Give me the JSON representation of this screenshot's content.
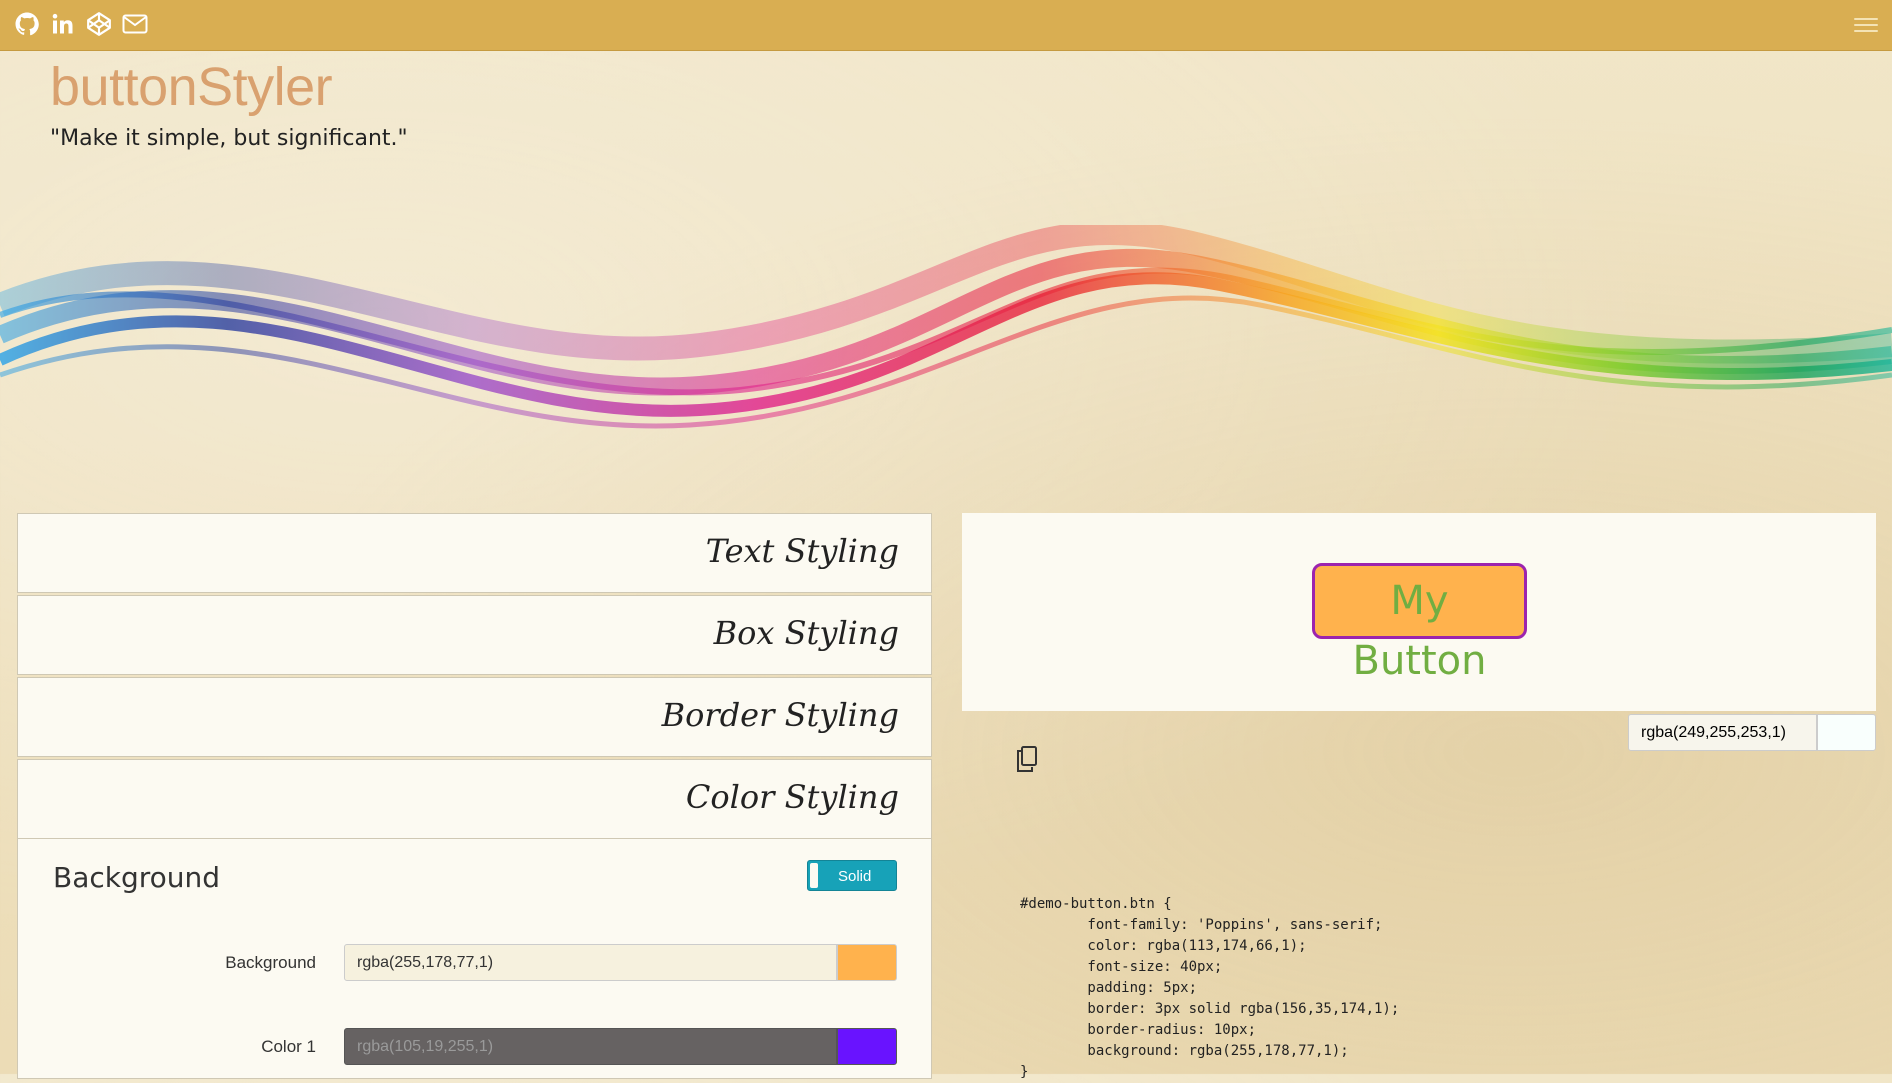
{
  "nav": {
    "icons": [
      "github-icon",
      "linkedin-icon",
      "codepen-icon",
      "mail-icon"
    ],
    "menu_icon": "hamburger-menu-icon"
  },
  "brand": "buttonStyler",
  "tagline": "\"Make it simple, but significant.\"",
  "accordion": {
    "sections": [
      "Text Styling",
      "Box Styling",
      "Border Styling",
      "Color Styling"
    ]
  },
  "color_styling": {
    "title": "Background",
    "toggle_label": "Solid",
    "fields": [
      {
        "label": "Background",
        "value": "rgba(255,178,77,1)",
        "swatch": "#ffb24d"
      },
      {
        "label": "Color 1",
        "value": "rgba(105,19,255,1)",
        "swatch": "#6913ff"
      }
    ]
  },
  "preview": {
    "button_label": "My Button",
    "bg_value": "rgba(249,255,253,1)"
  },
  "code": {
    "line1": "#demo-button.btn {",
    "line2": "        font-family: 'Poppins', sans-serif;",
    "line3": "        color: rgba(113,174,66,1);",
    "line4": "        font-size: 40px;",
    "line5": "        padding: 5px;",
    "line6": "        border: 3px solid rgba(156,35,174,1);",
    "line7": "        border-radius: 10px;",
    "line8": "        background: rgba(255,178,77,1);",
    "line9": "}"
  },
  "colors": {
    "navbar": "#d9ae52",
    "brand": "#d9a16f",
    "toggle": "#17a2b8"
  }
}
